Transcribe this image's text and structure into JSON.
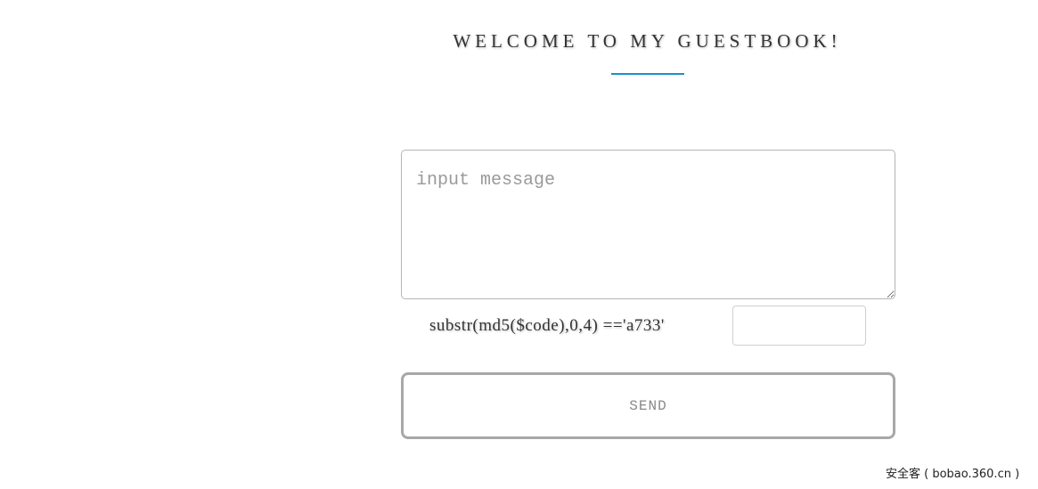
{
  "header": {
    "title": "WELCOME TO MY GUESTBOOK!",
    "underline_color": "#1a8fd0"
  },
  "form": {
    "message_placeholder": "input message",
    "message_value": "",
    "captcha_label": "substr(md5($code),0,4) =='a733'",
    "captcha_value": "",
    "send_label": "SEND"
  },
  "watermark": {
    "text": "安全客 ( bobao.360.cn )"
  }
}
